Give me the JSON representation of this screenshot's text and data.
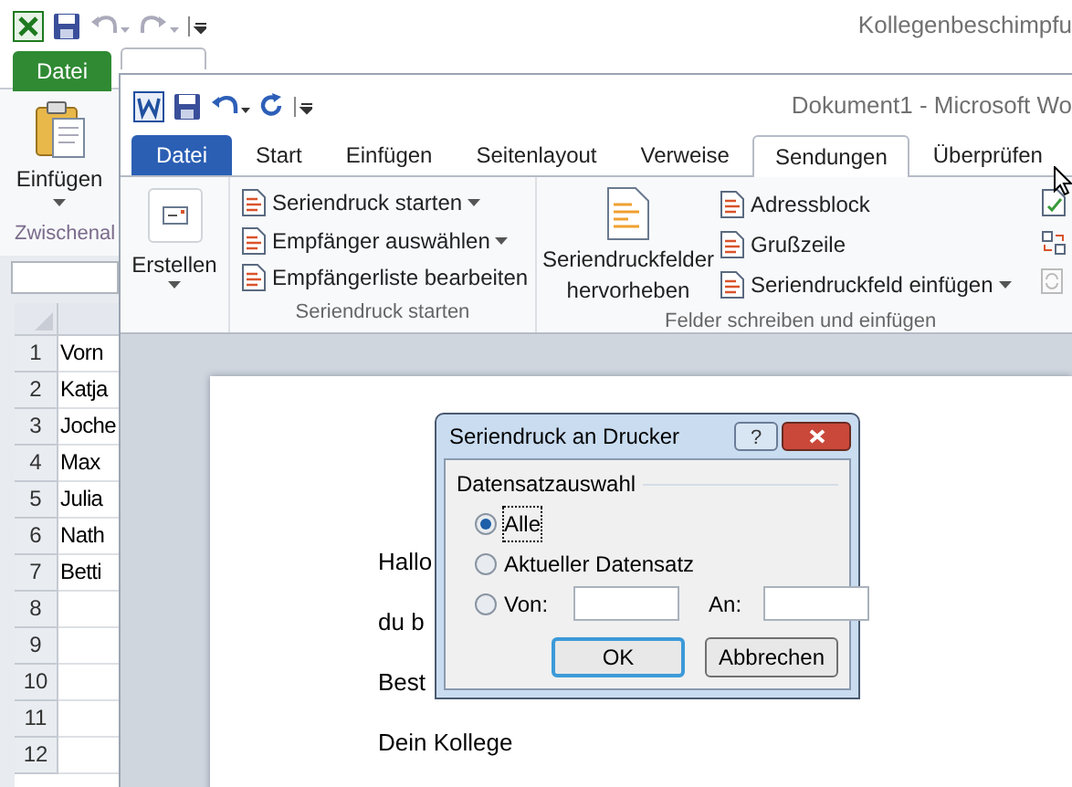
{
  "excel": {
    "title": "Kollegenbeschimpfu",
    "file_tab": "Datei",
    "paste_button": "Einfügen",
    "group_label": "Zwischenal",
    "rows": [
      {
        "number": "1",
        "cell": "Vorn"
      },
      {
        "number": "2",
        "cell": "Katja"
      },
      {
        "number": "3",
        "cell": "Joche"
      },
      {
        "number": "4",
        "cell": "Max"
      },
      {
        "number": "5",
        "cell": "Julia"
      },
      {
        "number": "6",
        "cell": "Nath"
      },
      {
        "number": "7",
        "cell": "Betti"
      },
      {
        "number": "8"
      },
      {
        "number": "9"
      },
      {
        "number": "10"
      },
      {
        "number": "11"
      },
      {
        "number": "12"
      }
    ]
  },
  "word": {
    "title": "Dokument1  -  Microsoft Wo",
    "tabs": [
      {
        "label": "Datei",
        "kind": "file",
        "selected": false
      },
      {
        "label": "Start",
        "kind": "tab",
        "selected": false
      },
      {
        "label": "Einfügen",
        "kind": "tab",
        "selected": false
      },
      {
        "label": "Seitenlayout",
        "kind": "tab",
        "selected": false
      },
      {
        "label": "Verweise",
        "kind": "tab",
        "selected": false
      },
      {
        "label": "Sendungen",
        "kind": "tab",
        "selected": true
      },
      {
        "label": "Überprüfen",
        "kind": "tab",
        "selected": false
      }
    ],
    "create_button": "Erstellen",
    "start_group": {
      "label": "Seriendruck starten",
      "items": [
        {
          "label": "Seriendruck starten",
          "dropdown": true
        },
        {
          "label": "Empfänger auswählen",
          "dropdown": true
        },
        {
          "label": "Empfängerliste bearbeiten",
          "dropdown": false
        }
      ]
    },
    "fields_group": {
      "label": "Felder schreiben und einfügen",
      "highlight_button": "Seriendruckfelder hervorheben",
      "items": [
        {
          "label": "Adressblock",
          "dropdown": false
        },
        {
          "label": "Grußzeile",
          "dropdown": false
        },
        {
          "label": "Seriendruckfeld einfügen",
          "dropdown": true
        }
      ]
    },
    "document": {
      "lines": [
        "Hallo",
        "du b",
        "Best",
        "Dein Kollege"
      ]
    }
  },
  "dialog": {
    "title": "Seriendruck an Drucker",
    "help": "?",
    "group_label": "Datensatzauswahl",
    "options": [
      {
        "label": "Alle",
        "kind": "plain",
        "selected": true
      },
      {
        "label": "Aktueller Datensatz",
        "kind": "plain",
        "selected": false
      },
      {
        "label": "Von:",
        "kind": "range",
        "selected": false,
        "to_label": "An:"
      }
    ],
    "buttons": [
      {
        "label": "OK",
        "default": true
      },
      {
        "label": "Abbrechen",
        "default": false
      }
    ]
  }
}
